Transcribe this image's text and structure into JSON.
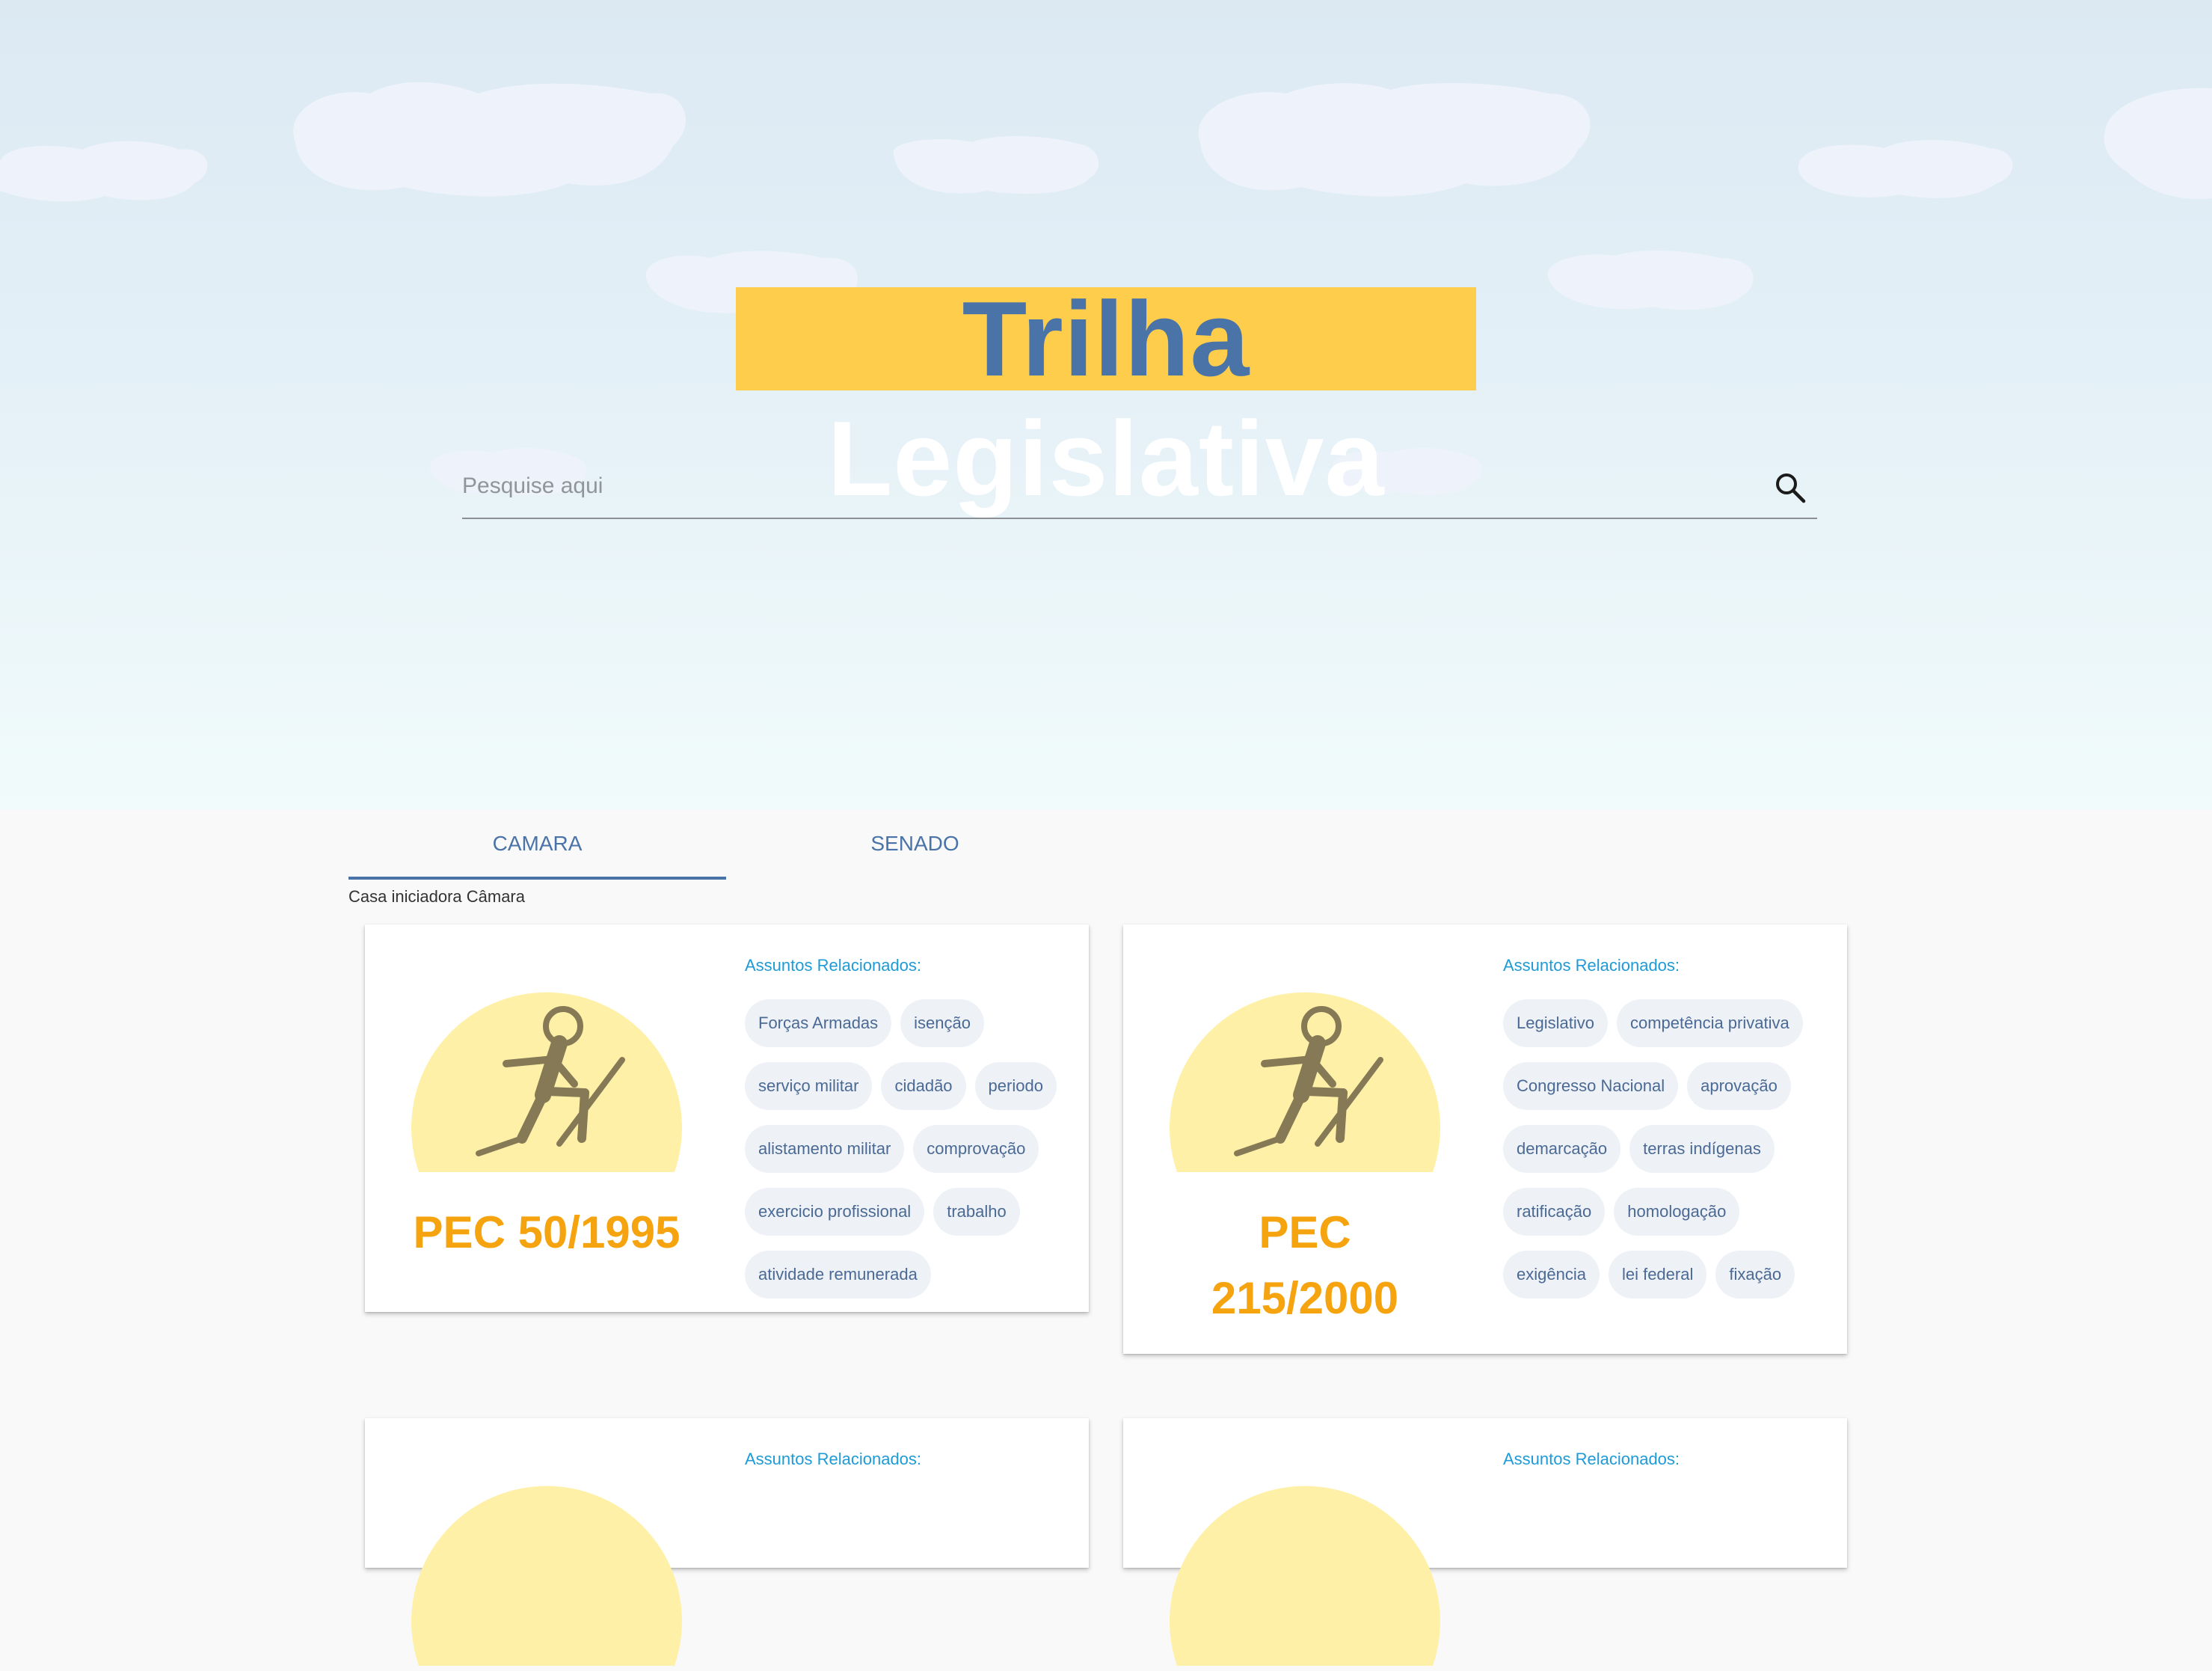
{
  "header": {
    "title_word1": "Trilha",
    "title_word2": "Legislativa",
    "accent_color": "#fecd4c",
    "title_blue": "#4a73a8"
  },
  "search": {
    "placeholder": "Pesquise aqui",
    "value": "",
    "icon": "search-icon"
  },
  "tabs": [
    {
      "label": "CAMARA",
      "active": true
    },
    {
      "label": "SENADO",
      "active": false
    }
  ],
  "house_label": "Casa iniciadora Câmara",
  "cards": [
    {
      "pec_line1": "PEC 50/1995",
      "pec_line2": "",
      "related_label": "Assuntos Relacionados:",
      "tags": [
        "Forças Armadas",
        "isenção",
        "serviço militar",
        "cidadão",
        "periodo",
        "alistamento militar",
        "comprovação",
        "exercicio profissional",
        "trabalho",
        "atividade remunerada"
      ]
    },
    {
      "pec_line1": "PEC",
      "pec_line2": "215/2000",
      "related_label": "Assuntos Relacionados:",
      "tags": [
        "Legislativo",
        "competência privativa",
        "Congresso Nacional",
        "aprovação",
        "demarcação",
        "terras indígenas",
        "ratificação",
        "homologação",
        "exigência",
        "lei federal",
        "fixação"
      ]
    },
    {
      "related_label": "Assuntos Relacionados:"
    },
    {
      "related_label": "Assuntos Relacionados:"
    }
  ],
  "colors": {
    "pec_orange": "#f5a30f",
    "related_blue": "#1e9ad6",
    "sun_yellow": "#fff0a8",
    "figure_olive": "#857a55"
  }
}
